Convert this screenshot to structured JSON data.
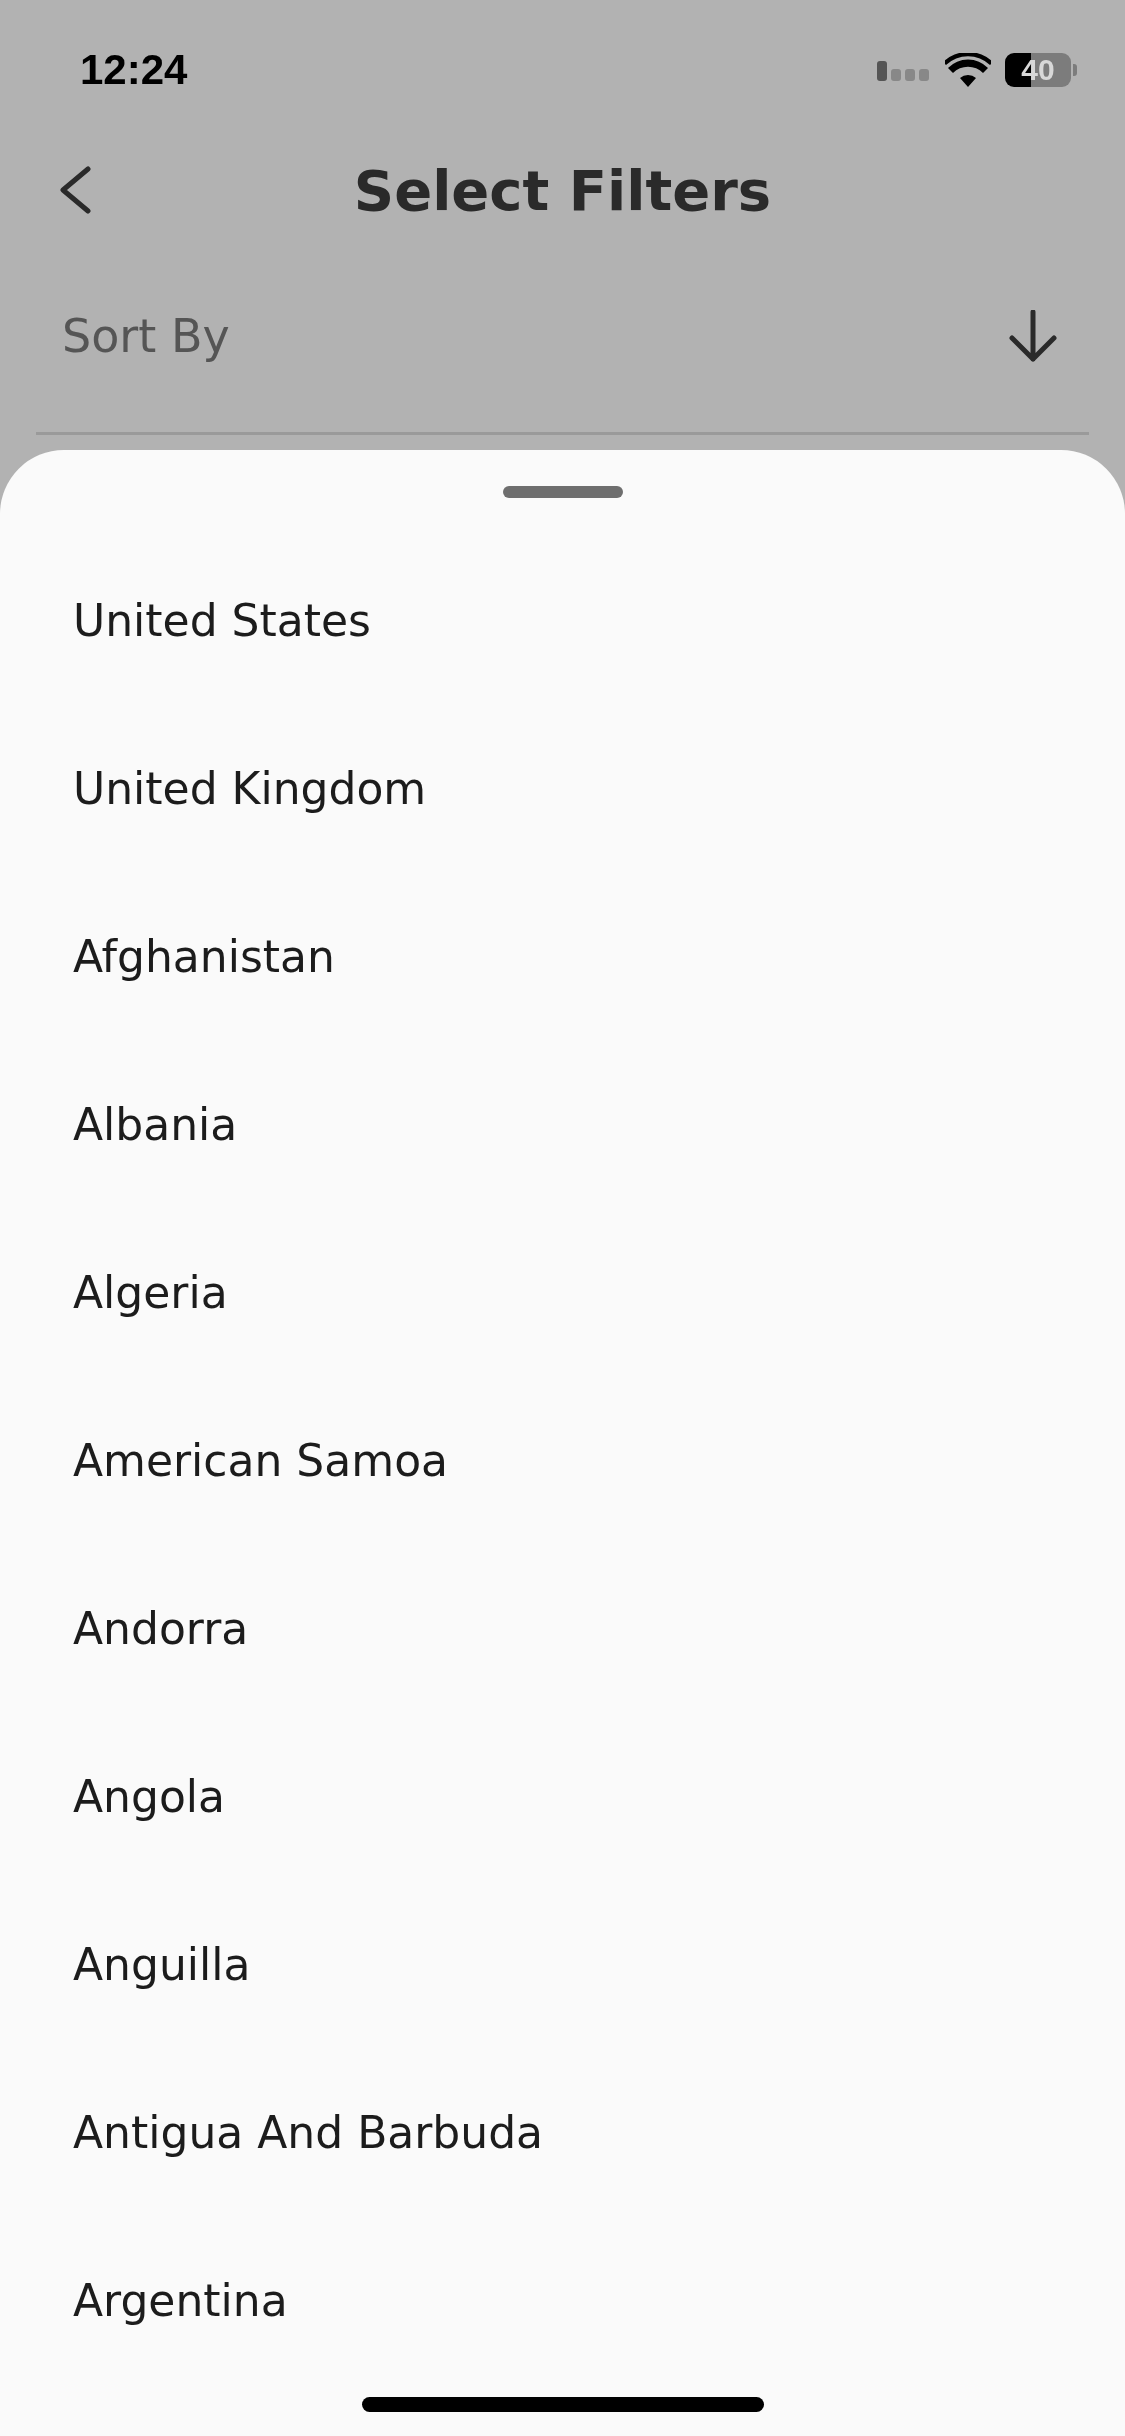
{
  "status_bar": {
    "time": "12:24",
    "battery": "40"
  },
  "header": {
    "title": "Select Filters"
  },
  "sort": {
    "label": "Sort By"
  },
  "sheet": {
    "items": [
      {
        "label": "United States"
      },
      {
        "label": "United Kingdom"
      },
      {
        "label": "Afghanistan"
      },
      {
        "label": "Albania"
      },
      {
        "label": "Algeria"
      },
      {
        "label": "American Samoa"
      },
      {
        "label": "Andorra"
      },
      {
        "label": "Angola"
      },
      {
        "label": "Anguilla"
      },
      {
        "label": "Antigua And Barbuda"
      },
      {
        "label": "Argentina"
      }
    ]
  }
}
